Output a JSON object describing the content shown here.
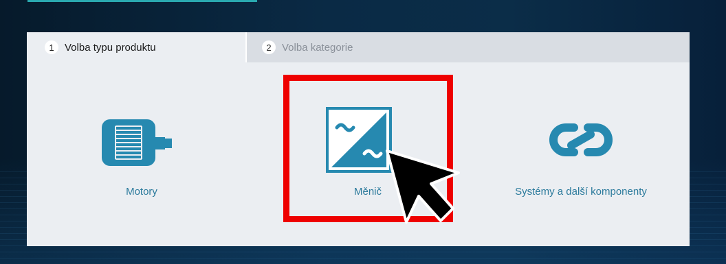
{
  "tabs": [
    {
      "number": "1",
      "label": "Volba typu produktu"
    },
    {
      "number": "2",
      "label": "Volba kategorie"
    }
  ],
  "options": [
    {
      "label": "Motory",
      "icon": "motor-icon"
    },
    {
      "label": "Měnič",
      "icon": "converter-icon"
    },
    {
      "label": "Systémy a další komponenty",
      "icon": "link-icon"
    }
  ],
  "colors": {
    "icon": "#2689b0",
    "label": "#2b7a9c",
    "highlight": "#ee0000",
    "accent": "#2aa9b0"
  }
}
